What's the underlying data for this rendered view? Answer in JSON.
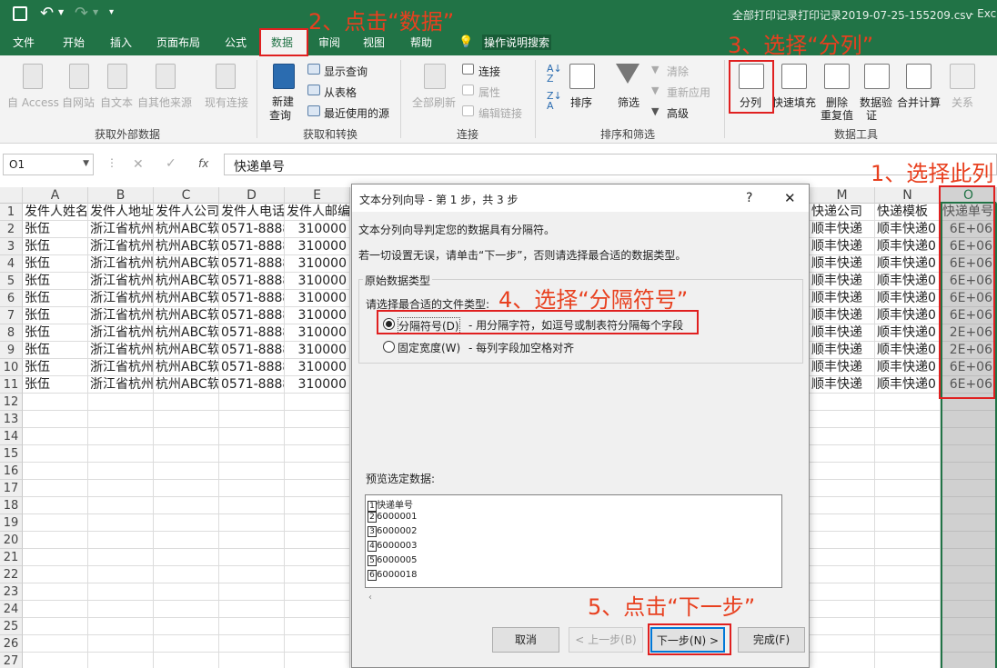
{
  "titlebar": {
    "file_name": "全部打印记录打印记录2019-07-25-155209.csv",
    "app_suffix": "- Exc"
  },
  "tabs": {
    "file": "文件",
    "home": "开始",
    "insert": "插入",
    "layout": "页面布局",
    "formula": "公式",
    "data": "数据",
    "review": "审阅",
    "view": "视图",
    "help": "帮助",
    "search": "操作说明搜索"
  },
  "ribbon": {
    "ext": {
      "access": "自 Access",
      "web": "自网站",
      "text": "自文本",
      "other": "自其他来源",
      "existing": "现有连接",
      "group": "获取外部数据"
    },
    "transform": {
      "new_query_1": "新建",
      "new_query_2": "查询",
      "show_query": "显示查询",
      "from_table": "从表格",
      "recent": "最近使用的源",
      "group": "获取和转换"
    },
    "connections": {
      "refresh": "全部刷新",
      "connections": "连接",
      "properties": "属性",
      "edit_links": "编辑链接",
      "group": "连接"
    },
    "sort": {
      "sort": "排序",
      "filter": "筛选",
      "clear": "清除",
      "reapply": "重新应用",
      "advanced": "高级",
      "group": "排序和筛选"
    },
    "tools": {
      "split": "分列",
      "flash": "快速填充",
      "remove_dup_1": "删除",
      "remove_dup_2": "重复值",
      "validate_1": "数据验",
      "validate_2": "证",
      "consolidate": "合并计算",
      "relations": "关系",
      "group": "数据工具"
    }
  },
  "formula_bar": {
    "name_box": "O1",
    "fx": "fx",
    "content": "快递单号"
  },
  "grid": {
    "columns": [
      "A",
      "B",
      "C",
      "D",
      "E",
      "M",
      "N",
      "O"
    ],
    "rows": [
      "1",
      "2",
      "3",
      "4",
      "5",
      "6",
      "7",
      "8",
      "9",
      "10",
      "11",
      "12",
      "13",
      "14",
      "15",
      "16",
      "17",
      "18",
      "19",
      "20",
      "21",
      "22",
      "23",
      "24",
      "25",
      "26",
      "27"
    ],
    "header_row": {
      "a": "发件人姓名",
      "b": "发件人地址",
      "c": "发件人公司",
      "d": "发件人电话",
      "e": "发件人邮编",
      "m": "快递公司",
      "n": "快递模板",
      "o": "快递单号"
    },
    "data": {
      "a": "张伍",
      "b": "浙江省杭州",
      "c": "杭州ABC软",
      "d": "0571-8888",
      "e": "310000",
      "m": "顺丰快递",
      "n": "顺丰快递0"
    },
    "o_values": [
      "6E+06",
      "6E+06",
      "6E+06",
      "6E+06",
      "6E+06",
      "6E+06",
      "2E+06",
      "2E+06",
      "6E+06",
      "6E+06"
    ]
  },
  "dialog": {
    "title": "文本分列向导 - 第 1 步，共 3 步",
    "help": "?",
    "close": "✕",
    "intro": "文本分列向导判定您的数据具有分隔符。",
    "hint": "若一切设置无误，请单击“下一步”，否则请选择最合适的数据类型。",
    "section": "原始数据类型",
    "choose": "请选择最合适的文件类型:",
    "opt1_label": "分隔符号(D)",
    "opt1_desc": "- 用分隔字符，如逗号或制表符分隔每个字段",
    "opt2_label": "固定宽度(W)",
    "opt2_desc": "- 每列字段加空格对齐",
    "preview_label": "预览选定数据:",
    "preview_rows": [
      {
        "n": "1",
        "v": "快递单号"
      },
      {
        "n": "2",
        "v": "6000001"
      },
      {
        "n": "3",
        "v": "6000002"
      },
      {
        "n": "4",
        "v": "6000003"
      },
      {
        "n": "5",
        "v": "6000005"
      },
      {
        "n": "6",
        "v": "6000018"
      }
    ],
    "cancel": "取消",
    "back": "< 上一步(B)",
    "next": "下一步(N) >",
    "finish": "完成(F)"
  },
  "annotations": {
    "step1": "1、选择此列",
    "step2": "2、点击“数据”",
    "step3": "3、选择“分列”",
    "step4": "4、选择“分隔符号”",
    "step5": "5、点击“下一步”"
  },
  "colors": {
    "excel_green": "#217346",
    "annotation": "#e8401f",
    "selected_col": "#c6c6c6"
  }
}
